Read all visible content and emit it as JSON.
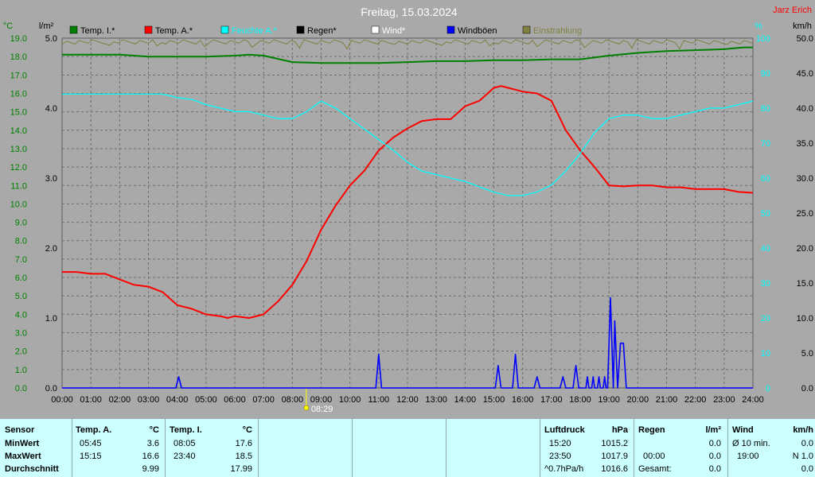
{
  "chart_data": {
    "type": "line",
    "title": "Freitag, 15.03.2024",
    "author": "Jarz Erich",
    "x_ticks": [
      "00:00",
      "01:00",
      "02:00",
      "03:00",
      "04:00",
      "05:00",
      "06:00",
      "07:00",
      "08:00",
      "09:00",
      "10:00",
      "11:00",
      "12:00",
      "13:00",
      "14:00",
      "15:00",
      "16:00",
      "17:00",
      "18:00",
      "19:00",
      "20:00",
      "21:00",
      "22:00",
      "23:00",
      "24:00"
    ],
    "sunrise_marker": "08:29",
    "axes": {
      "temp": {
        "unit": "°C",
        "ylim": [
          0,
          19
        ],
        "ticks": [
          "0.0",
          "1.0",
          "2.0",
          "3.0",
          "4.0",
          "5.0",
          "6.0",
          "7.0",
          "8.0",
          "9.0",
          "10.0",
          "11.0",
          "12.0",
          "13.0",
          "14.0",
          "15.0",
          "16.0",
          "17.0",
          "18.0",
          "19.0"
        ]
      },
      "rain": {
        "unit": "l/m²",
        "ylim": [
          0,
          5
        ],
        "ticks": [
          "0.0",
          "1.0",
          "2.0",
          "3.0",
          "4.0",
          "5.0"
        ]
      },
      "humidity": {
        "unit": "%",
        "ylim": [
          0,
          100
        ],
        "ticks": [
          "0",
          "10",
          "20",
          "30",
          "40",
          "50",
          "60",
          "70",
          "80",
          "90",
          "100"
        ]
      },
      "wind": {
        "unit": "km/h",
        "ylim": [
          0,
          50
        ],
        "ticks": [
          "0.0",
          "5.0",
          "10.0",
          "15.0",
          "20.0",
          "25.0",
          "30.0",
          "35.0",
          "40.0",
          "45.0",
          "50.0"
        ]
      }
    },
    "legend": [
      {
        "label": "Temp. I.*",
        "color": "#008000"
      },
      {
        "label": "Temp. A.*",
        "color": "#ff0000"
      },
      {
        "label": "Feuchte A.*",
        "color": "#00ffff"
      },
      {
        "label": "Regen*",
        "color": "#000000"
      },
      {
        "label": "Wind*",
        "color": "#ffffff"
      },
      {
        "label": "Windböen",
        "color": "#0000ff"
      },
      {
        "label": "Einstrahlung",
        "color": "#808040"
      }
    ],
    "series": [
      {
        "name": "Temp. I.*",
        "axis": "temp",
        "color": "#008000",
        "x": [
          0,
          1,
          2,
          3,
          4,
          5,
          6,
          6.5,
          7,
          8,
          9,
          10,
          11,
          12,
          13,
          14,
          15,
          16,
          17,
          17.5,
          18,
          19,
          20,
          21,
          22,
          23,
          23.67,
          24
        ],
        "values": [
          18.1,
          18.1,
          18.1,
          18.0,
          18.0,
          18.0,
          18.05,
          18.1,
          18.05,
          17.7,
          17.65,
          17.65,
          17.65,
          17.7,
          17.75,
          17.75,
          17.8,
          17.8,
          17.85,
          17.85,
          17.85,
          18.05,
          18.2,
          18.3,
          18.35,
          18.4,
          18.5,
          18.5
        ]
      },
      {
        "name": "Temp. A.*",
        "axis": "temp",
        "color": "#ff0000",
        "x": [
          0,
          0.5,
          1,
          1.5,
          2,
          2.5,
          3,
          3.5,
          4,
          4.5,
          5,
          5.5,
          5.75,
          6,
          6.5,
          7,
          7.5,
          8,
          8.5,
          9,
          9.5,
          10,
          10.5,
          11,
          11.5,
          12,
          12.5,
          13,
          13.5,
          14,
          14.5,
          15,
          15.25,
          15.5,
          16,
          16.5,
          17,
          17.5,
          18,
          18.5,
          19,
          19.5,
          20,
          20.5,
          21,
          21.5,
          22,
          22.5,
          23,
          23.5,
          24
        ],
        "values": [
          6.3,
          6.3,
          6.2,
          6.2,
          5.9,
          5.6,
          5.5,
          5.2,
          4.5,
          4.3,
          4.0,
          3.9,
          3.8,
          3.9,
          3.8,
          4.0,
          4.7,
          5.6,
          6.9,
          8.6,
          9.9,
          11.0,
          11.8,
          12.9,
          13.6,
          14.1,
          14.5,
          14.6,
          14.6,
          15.3,
          15.6,
          16.3,
          16.4,
          16.3,
          16.1,
          16.0,
          15.6,
          14.0,
          12.9,
          12.0,
          11.0,
          10.95,
          11.0,
          11.0,
          10.9,
          10.9,
          10.8,
          10.8,
          10.8,
          10.65,
          10.6
        ]
      },
      {
        "name": "Feuchte A.*",
        "axis": "humidity",
        "color": "#00ffff",
        "x": [
          0,
          1,
          2,
          3,
          3.5,
          4,
          4.5,
          5,
          5.5,
          6,
          6.5,
          7,
          7.5,
          8,
          8.5,
          9,
          9.5,
          10,
          10.5,
          11,
          11.5,
          12,
          12.5,
          13,
          13.5,
          14,
          14.5,
          15,
          15.5,
          16,
          16.5,
          17,
          17.5,
          18,
          18.5,
          19,
          19.5,
          20,
          20.5,
          21,
          21.5,
          22,
          22.5,
          23,
          23.5,
          24
        ],
        "values": [
          84,
          84,
          84,
          84,
          84,
          83,
          82.5,
          81,
          80,
          79,
          79,
          78,
          77,
          77,
          79,
          82,
          80,
          77,
          74,
          71,
          68,
          64.5,
          62,
          61,
          60,
          59,
          57.5,
          56,
          55,
          55,
          56,
          58,
          62,
          67,
          73,
          77,
          78,
          78,
          77,
          77,
          78,
          79,
          80,
          80,
          81,
          82
        ]
      },
      {
        "name": "Windböen",
        "axis": "wind",
        "color": "#0000ff",
        "x": [
          0,
          3.95,
          4.05,
          4.15,
          10.9,
          11.0,
          11.1,
          15.05,
          15.15,
          15.25,
          15.65,
          15.75,
          15.85,
          16.4,
          16.5,
          16.6,
          17.3,
          17.4,
          17.5,
          17.75,
          17.85,
          17.95,
          18.2,
          18.25,
          18.3,
          18.4,
          18.45,
          18.5,
          18.6,
          18.65,
          18.7,
          18.8,
          18.85,
          18.9,
          18.95,
          19.05,
          19.15,
          19.2,
          19.3,
          19.4,
          19.5,
          19.6,
          19.7,
          19.8,
          24
        ],
        "values": [
          0,
          0,
          1.6,
          0,
          0,
          4.8,
          0,
          0,
          3.2,
          0,
          0,
          4.8,
          0,
          0,
          1.6,
          0,
          0,
          1.6,
          0,
          0,
          3.2,
          0,
          0,
          1.6,
          0,
          0,
          1.6,
          0,
          0,
          1.6,
          0,
          0,
          1.6,
          0,
          0,
          12.9,
          0,
          9.6,
          0,
          6.4,
          6.4,
          0,
          0,
          0,
          0
        ]
      }
    ]
  },
  "stats_table": {
    "sensor": {
      "header": "Sensor",
      "rows": [
        "MinWert",
        "MaxWert",
        "Durchschnitt"
      ]
    },
    "temp_a": {
      "header": "Temp. A.",
      "unit": "°C",
      "min_time": "05:45",
      "min": "3.6",
      "max_time": "15:15",
      "max": "16.6",
      "avg": "9.99"
    },
    "temp_i": {
      "header": "Temp. I.",
      "unit": "°C",
      "min_time": "08:05",
      "min": "17.6",
      "max_time": "23:40",
      "max": "18.5",
      "avg": "17.99"
    },
    "luftdruck": {
      "header": "Luftdruck",
      "unit": "hPa",
      "min_time": "15:20",
      "min": "1015.2",
      "max_time": "23:50",
      "max": "1017.9",
      "trend_label": "^0.7hPa/h",
      "trend_value": "1016.6"
    },
    "regen": {
      "header": "Regen",
      "unit": "l/m²",
      "min": "0.0",
      "max_time": "00:00",
      "max": "0.0",
      "total_label": "Gesamt:",
      "total": "0.0"
    },
    "wind": {
      "header": "Wind",
      "unit": "km/h",
      "avg_label": "Ø 10 min.",
      "avg": "0.0",
      "max_time": "19:00",
      "max": "N 1.0",
      "extra": "0.0"
    }
  }
}
